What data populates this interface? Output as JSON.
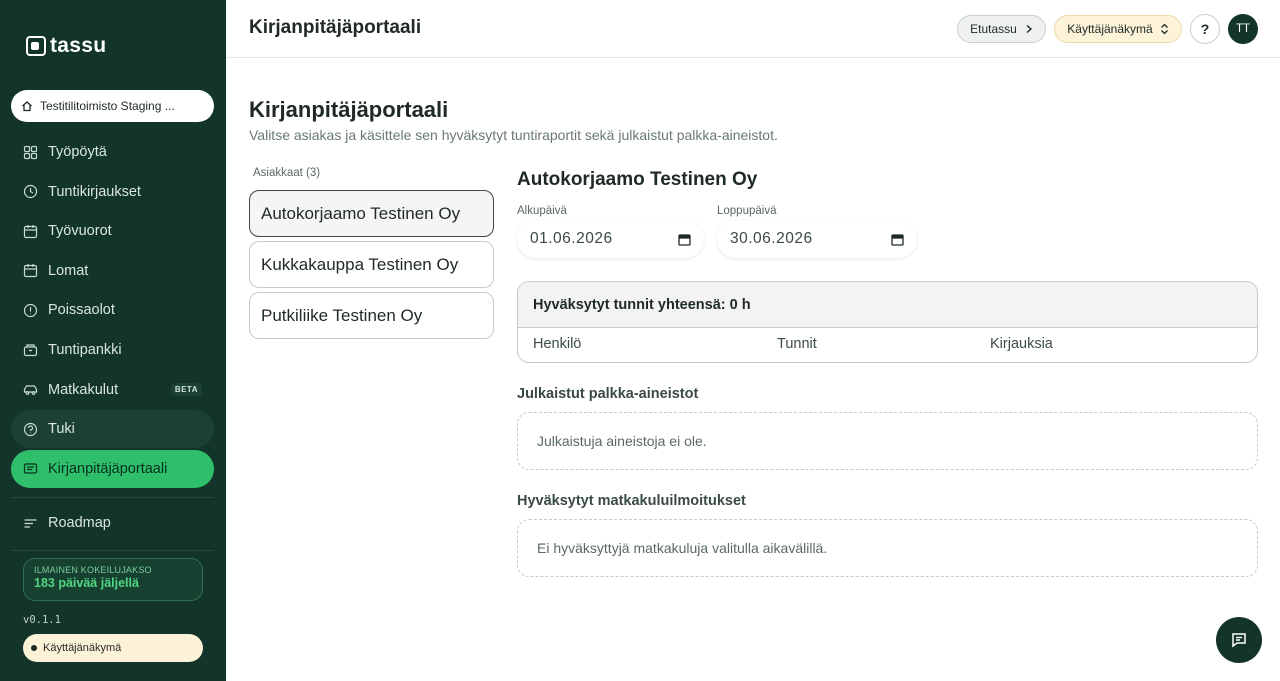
{
  "app": {
    "logo_text": "tassu",
    "org_name": "Testitilitoimisto Staging ..."
  },
  "sidebar": {
    "items": [
      {
        "label": "Työpöytä",
        "icon": "grid-icon"
      },
      {
        "label": "Tuntikirjaukset",
        "icon": "clock-icon"
      },
      {
        "label": "Työvuorot",
        "icon": "calendar-icon"
      },
      {
        "label": "Lomat",
        "icon": "calendar-icon"
      },
      {
        "label": "Poissaolot",
        "icon": "alert-circle-icon"
      },
      {
        "label": "Tuntipankki",
        "icon": "piggy-bank-icon"
      },
      {
        "label": "Matkakulut",
        "icon": "car-icon",
        "badge": "BETA"
      },
      {
        "label": "Tuki",
        "icon": "help-circle-icon"
      },
      {
        "label": "Kirjanpitäjäportaali",
        "icon": "id-card-icon"
      }
    ],
    "roadmap_label": "Roadmap",
    "trial_label": "ILMAINEN KOKEILUJAKSO",
    "trial_days": "183 päivää jäljellä",
    "version": "v0.1.1",
    "view_label": "Käyttäjänäkymä"
  },
  "topbar": {
    "title": "Kirjanpitäjäportaali",
    "etutassu_label": "Etutassu",
    "view_label": "Käyttäjänäkymä",
    "help_label": "?",
    "avatar_initials": "TT"
  },
  "main": {
    "title": "Kirjanpitäjäportaali",
    "subtitle": "Valitse asiakas ja käsittele sen hyväksytyt tuntiraportit sekä julkaistut palkka-aineistot.",
    "clients_label": "Asiakkaat (3)",
    "clients": [
      "Autokorjaamo Testinen Oy",
      "Kukkakauppa Testinen Oy",
      "Putkiliike Testinen Oy"
    ],
    "selected_client": "Autokorjaamo Testinen Oy",
    "start_label": "Alkupäivä",
    "start_date": "01.06.2026",
    "end_label": "Loppupäivä",
    "end_date": "30.06.2026",
    "hours_total": "Hyväksytyt tunnit yhteensä: 0 h",
    "columns": [
      "Henkilö",
      "Tunnit",
      "Kirjauksia"
    ],
    "payroll_label": "Julkaistut palkka-aineistot",
    "payroll_empty": "Julkaistuja aineistoja ei ole.",
    "travel_label": "Hyväksytyt matkakuluilmoitukset",
    "travel_empty": "Ei hyväksyttyjä matkakuluja valitulla aikavälillä."
  },
  "colors": {
    "sidebar_bg": "#12342b",
    "accent_green": "#2fbf6a",
    "view_pill": "#fcf3d9"
  }
}
